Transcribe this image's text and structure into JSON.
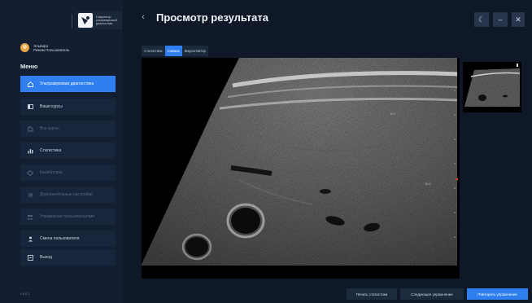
{
  "app": {
    "logo_text": "Симулятор ультразвуковой диагностики",
    "logo_lines": [
      "Симулятор",
      "ультразвуковой",
      "диагностики"
    ]
  },
  "user": {
    "name": "Эльвира",
    "mode": "Режим Пользователь"
  },
  "sidebar": {
    "menu_title": "Меню",
    "items": [
      {
        "label": "Ультразвуковая диагностика",
        "icon": "home-icon",
        "state": "active"
      },
      {
        "label": "Ваши курсы",
        "icon": "book-icon",
        "state": "normal"
      },
      {
        "label": "Все курсы",
        "icon": "courses-icon",
        "state": "disabled"
      },
      {
        "label": "Статистика",
        "icon": "chart-icon",
        "state": "normal"
      },
      {
        "label": "Калибровка",
        "icon": "calibration-icon",
        "state": "disabled"
      },
      {
        "label": "Дополнительные настройки",
        "icon": "gear-icon",
        "state": "disabled"
      },
      {
        "label": "Управление пользователями",
        "icon": "users-icon",
        "state": "disabled"
      },
      {
        "label": "Смена пользователя",
        "icon": "user-icon",
        "state": "normal"
      },
      {
        "label": "Выход",
        "icon": "exit-icon",
        "state": "normal"
      }
    ],
    "version": "v.0.0.1"
  },
  "header": {
    "title": "Просмотр результата",
    "buttons": [
      {
        "name": "theme-toggle",
        "icon": "moon-icon",
        "glyph": "☾"
      },
      {
        "name": "minimize",
        "icon": "minimize-icon",
        "glyph": "–"
      },
      {
        "name": "close",
        "icon": "close-icon",
        "glyph": "✕"
      }
    ]
  },
  "tabs": [
    {
      "label": "Статистика",
      "active": false
    },
    {
      "label": "Снимок",
      "active": true
    },
    {
      "label": "Видеоповтор",
      "active": false
    }
  ],
  "image": {
    "depth_markers": [
      "5.0",
      "10.0"
    ]
  },
  "footer": {
    "print_stats": "Печать статистики",
    "next_exercise": "Следующее упражнение",
    "repeat_exercise": "Повторить упражнение"
  },
  "colors": {
    "accent": "#2f7ff0",
    "background": "#0f1826",
    "sidebar": "#131f30"
  }
}
